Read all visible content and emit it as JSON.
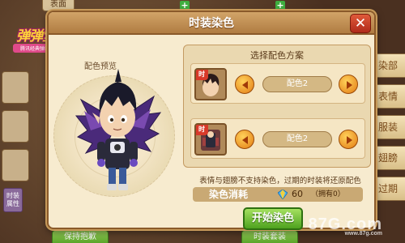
{
  "dialog": {
    "title": "时装染色",
    "close_icon": "close-icon",
    "preview_label": "配色预览",
    "scheme_title": "选择配色方案",
    "rows": [
      {
        "slot_tag": "时",
        "color_name": "配色2"
      },
      {
        "slot_tag": "时",
        "color_name": "配色2"
      }
    ],
    "notice": "表情与翅膀不支持染色，过期的时装将还原配色",
    "cost_label": "染色消耗",
    "cost_icon": "gem-icon",
    "cost_value": "60",
    "cost_owned": "（拥有0）",
    "start_button": "开始染色"
  },
  "background": {
    "top_tabs": [
      "表面",
      "",
      ""
    ],
    "side_tabs": [
      "染部",
      "表情",
      "服装",
      "翅膀",
      "过期"
    ],
    "left_attr": "时装属性",
    "bottom_buttons": [
      "保持抱歉",
      "时装套装"
    ],
    "logo_title": "弹弹堂2",
    "logo_sub": "腾讯经典弹射游戏"
  },
  "watermark": {
    "text": "87G.com",
    "sub": "www.87g.com"
  },
  "colors": {
    "accent_orange": "#e27a14",
    "start_green": "#4ea21e",
    "close_red": "#b02a1a"
  }
}
